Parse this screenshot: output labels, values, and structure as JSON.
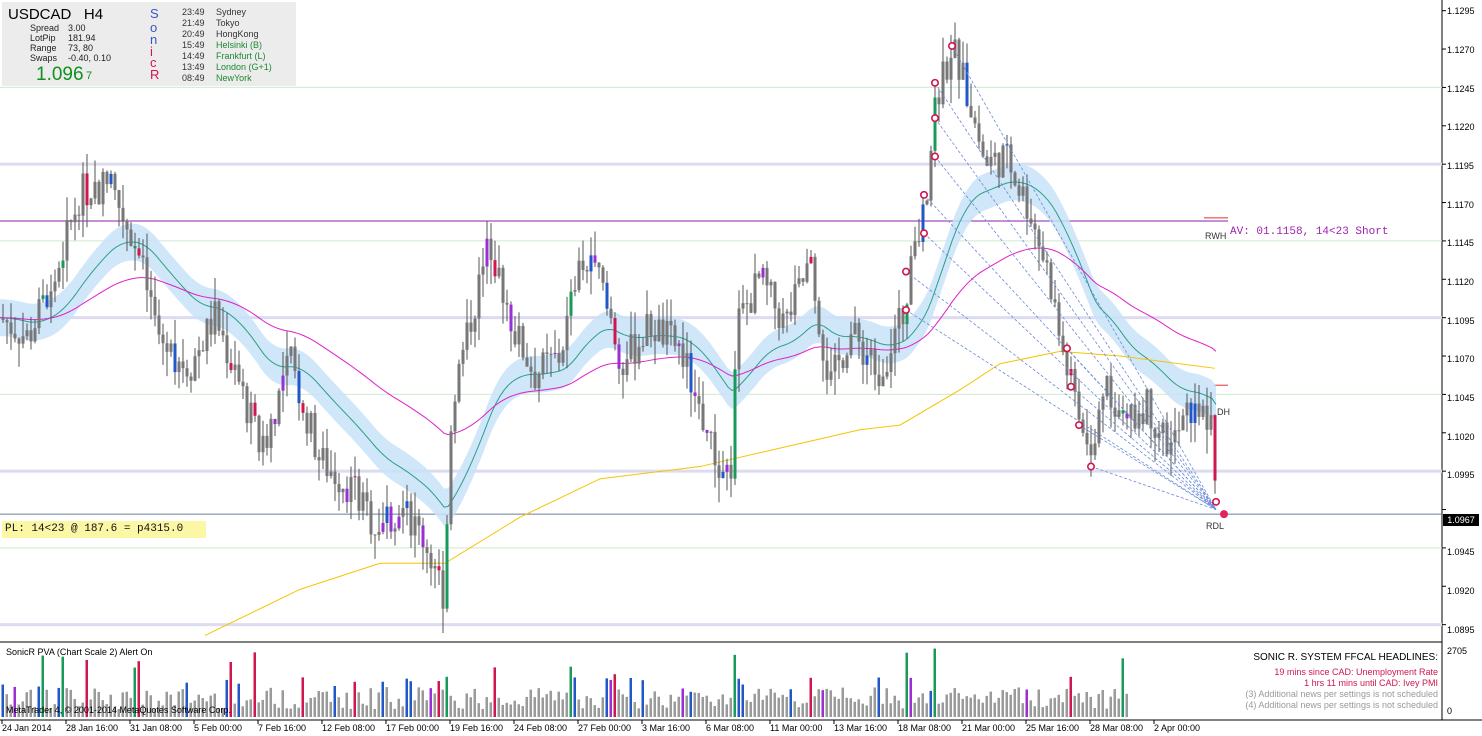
{
  "header": {
    "symbol": "USDCAD",
    "timeframe": "H4",
    "spread_label": "Spread",
    "spread": "3.00",
    "lotpip_label": "LotPip",
    "lotpip": "181.94",
    "range_label": "Range",
    "range": "73, 80",
    "swaps_label": "Swaps",
    "swaps": "-0.40, 0.10",
    "price_big": "1.096",
    "price_small": "7"
  },
  "sonic_letters": [
    "S",
    "o",
    "n",
    "i",
    "c",
    "R"
  ],
  "sessions": [
    {
      "time": "23:49",
      "name": "Sydney"
    },
    {
      "time": "21:49",
      "name": "Tokyo"
    },
    {
      "time": "20:49",
      "name": "HongKong"
    },
    {
      "time": "15:49",
      "name": "Helsinki  (B)"
    },
    {
      "time": "14:49",
      "name": "Frankfurt  (L)"
    },
    {
      "time": "13:49",
      "name": "London  (G+1)"
    },
    {
      "time": "08:49",
      "name": "NewYork"
    }
  ],
  "annotations": {
    "pl": "PL: 14<23 @ 187.6 = p4315.0",
    "av": "AV: 01.1158, 14<23 Short",
    "rwh": "RWH",
    "rdl": "RDL",
    "dh": "DH"
  },
  "y_axis_labels": [
    "1.1295",
    "1.1270",
    "1.1245",
    "1.1220",
    "1.1195",
    "1.1170",
    "1.1145",
    "1.1120",
    "1.1095",
    "1.1070",
    "1.1045",
    "1.1020",
    "1.0995",
    "1.0970",
    "1.0945",
    "1.0920",
    "1.0895"
  ],
  "current_price": "1.0967",
  "x_axis_labels": [
    "24 Jan 2014",
    "28 Jan 16:00",
    "31 Jan 08:00",
    "5 Feb 00:00",
    "7 Feb 16:00",
    "12 Feb 08:00",
    "17 Feb 00:00",
    "19 Feb 16:00",
    "24 Feb 08:00",
    "27 Feb 00:00",
    "3 Mar 16:00",
    "6 Mar 08:00",
    "11 Mar 00:00",
    "13 Mar 16:00",
    "18 Mar 08:00",
    "21 Mar 00:00",
    "25 Mar 16:00",
    "28 Mar 08:00",
    "2 Apr 00:00"
  ],
  "volume_panel": {
    "title": "SonicR PVA  (Chart Scale 2)   Alert On",
    "axis_top": "2705",
    "axis_bottom": "0",
    "copyright": "MetaTrader 4, © 2001-2014 MetaQuotes Software Corp."
  },
  "headlines": {
    "title": "SONIC R. SYSTEM  FFCAL HEADLINES:",
    "line1": "19 mins since CAD: Unemployment Rate",
    "line2": "1 hrs 11 mins until CAD: Ivey PMI",
    "line3": "(3)  Additional news per settings is not scheduled",
    "line4": "(4)  Additional news per settings is not scheduled"
  },
  "colors": {
    "bull_climax": "#1a9a5a",
    "bear_climax": "#d0164f",
    "rising_vol": "#2257c8",
    "churn": "#9a2fd6",
    "normal": "#8e8e8e",
    "dragon_band": "#c8e2f8",
    "ema89": "#e020c8",
    "ema200": "#f5c400",
    "ema34": "#2aa08a"
  },
  "chart_data": {
    "type": "candlestick",
    "symbol": "USDCAD",
    "timeframe": "H4",
    "ylim": [
      1.0885,
      1.13
    ],
    "close_path": [
      [
        0,
        1.1095
      ],
      [
        28,
        1.1082
      ],
      [
        55,
        1.112
      ],
      [
        80,
        1.1176
      ],
      [
        110,
        1.1183
      ],
      [
        137,
        1.114
      ],
      [
        160,
        1.108
      ],
      [
        190,
        1.1063
      ],
      [
        215,
        1.1096
      ],
      [
        240,
        1.105
      ],
      [
        262,
        1.1008
      ],
      [
        290,
        1.1068
      ],
      [
        320,
        1.1002
      ],
      [
        350,
        1.0985
      ],
      [
        375,
        1.096
      ],
      [
        400,
        1.0972
      ],
      [
        425,
        1.095
      ],
      [
        444,
        1.0915
      ],
      [
        452,
        1.104
      ],
      [
        470,
        1.1092
      ],
      [
        490,
        1.1145
      ],
      [
        515,
        1.1085
      ],
      [
        535,
        1.1058
      ],
      [
        560,
        1.107
      ],
      [
        580,
        1.113
      ],
      [
        600,
        1.112
      ],
      [
        620,
        1.1062
      ],
      [
        650,
        1.109
      ],
      [
        680,
        1.1075
      ],
      [
        700,
        1.1035
      ],
      [
        716,
        1.1
      ],
      [
        730,
        1.0985
      ],
      [
        738,
        1.1092
      ],
      [
        760,
        1.112
      ],
      [
        785,
        1.109
      ],
      [
        810,
        1.113
      ],
      [
        830,
        1.105
      ],
      [
        850,
        1.1085
      ],
      [
        880,
        1.106
      ],
      [
        905,
        1.11
      ],
      [
        912,
        1.113
      ],
      [
        925,
        1.1165
      ],
      [
        935,
        1.1235
      ],
      [
        952,
        1.1272
      ],
      [
        970,
        1.1235
      ],
      [
        985,
        1.1195
      ],
      [
        1005,
        1.12
      ],
      [
        1030,
        1.1165
      ],
      [
        1050,
        1.112
      ],
      [
        1060,
        1.108
      ],
      [
        1075,
        1.104
      ],
      [
        1092,
        1.0998
      ],
      [
        1105,
        1.106
      ],
      [
        1125,
        1.102
      ],
      [
        1145,
        1.104
      ],
      [
        1170,
        1.101
      ],
      [
        1195,
        1.104
      ],
      [
        1212,
        1.102
      ],
      [
        1216,
        1.0975
      ]
    ],
    "bull_climax_candles_x": [
      43,
      63,
      134,
      447,
      572,
      735,
      906,
      935,
      1122
    ],
    "bear_climax_candles_x": [
      88,
      139,
      232,
      255,
      302,
      355,
      440,
      494,
      614,
      717,
      812,
      1041,
      1071,
      1215
    ],
    "dragon_band": "light blue EMA channel",
    "ema89_color": "#e020c8",
    "ema200_color": "#f5c400",
    "horizontal_levels": [
      1.1158
    ],
    "volume_axis": [
      0,
      2705
    ]
  }
}
